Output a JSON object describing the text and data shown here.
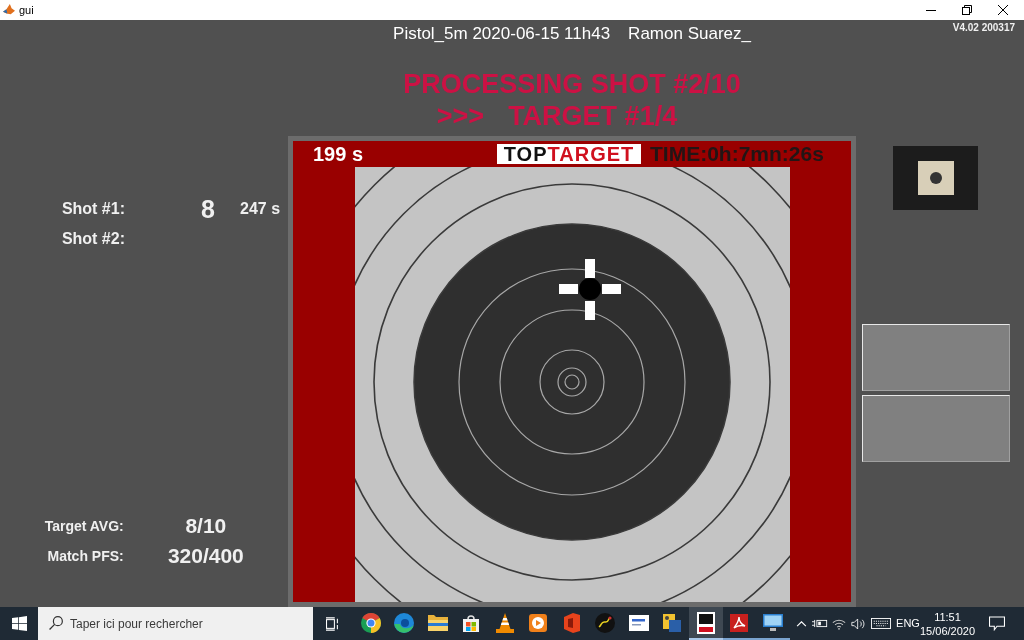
{
  "window": {
    "title": "gui"
  },
  "header": {
    "session": "Pistol_5m 2020-06-15 11h43",
    "shooter": "Ramon Suarez_",
    "version": "V4.02 200317",
    "status": "PROCESSING SHOT #2/10",
    "pointer": ">>>",
    "target": "TARGET #1/4"
  },
  "shots": [
    {
      "label": "Shot #1:",
      "score": "8",
      "time": "247 s"
    },
    {
      "label": "Shot #2:"
    }
  ],
  "stats": [
    {
      "label": "Target AVG:",
      "value": "8/10"
    },
    {
      "label": "Match PFS:",
      "value": "320/400"
    }
  ],
  "target_view": {
    "countdown": "199 s",
    "logo": {
      "first": "TOP",
      "second": "TARGET"
    },
    "elapsed": "TIME:0h:7mn:26s"
  },
  "taskbar": {
    "search": {
      "placeholder": "Taper ici pour rechercher"
    },
    "apps": [
      {
        "kind": "tricolor",
        "open": false,
        "selected": false
      },
      {
        "kind": "swirl",
        "open": false,
        "selected": false
      },
      {
        "kind": "folder",
        "open": false,
        "selected": false
      },
      {
        "kind": "bag",
        "open": false,
        "selected": false
      },
      {
        "kind": "cone",
        "open": false,
        "selected": false
      },
      {
        "kind": "player",
        "open": false,
        "selected": false
      },
      {
        "kind": "curve",
        "open": false,
        "selected": false
      },
      {
        "kind": "disc",
        "open": false,
        "selected": false
      },
      {
        "kind": "tile",
        "open": false,
        "selected": false
      },
      {
        "kind": "viewer",
        "open": false,
        "selected": false
      },
      {
        "kind": "logo",
        "open": true,
        "selected": true
      },
      {
        "kind": "pdf",
        "open": true,
        "selected": false
      },
      {
        "kind": "monitor",
        "open": true,
        "selected": false
      }
    ],
    "tray": {
      "language": "ENG",
      "time": "11:51",
      "date": "15/06/2020"
    }
  }
}
